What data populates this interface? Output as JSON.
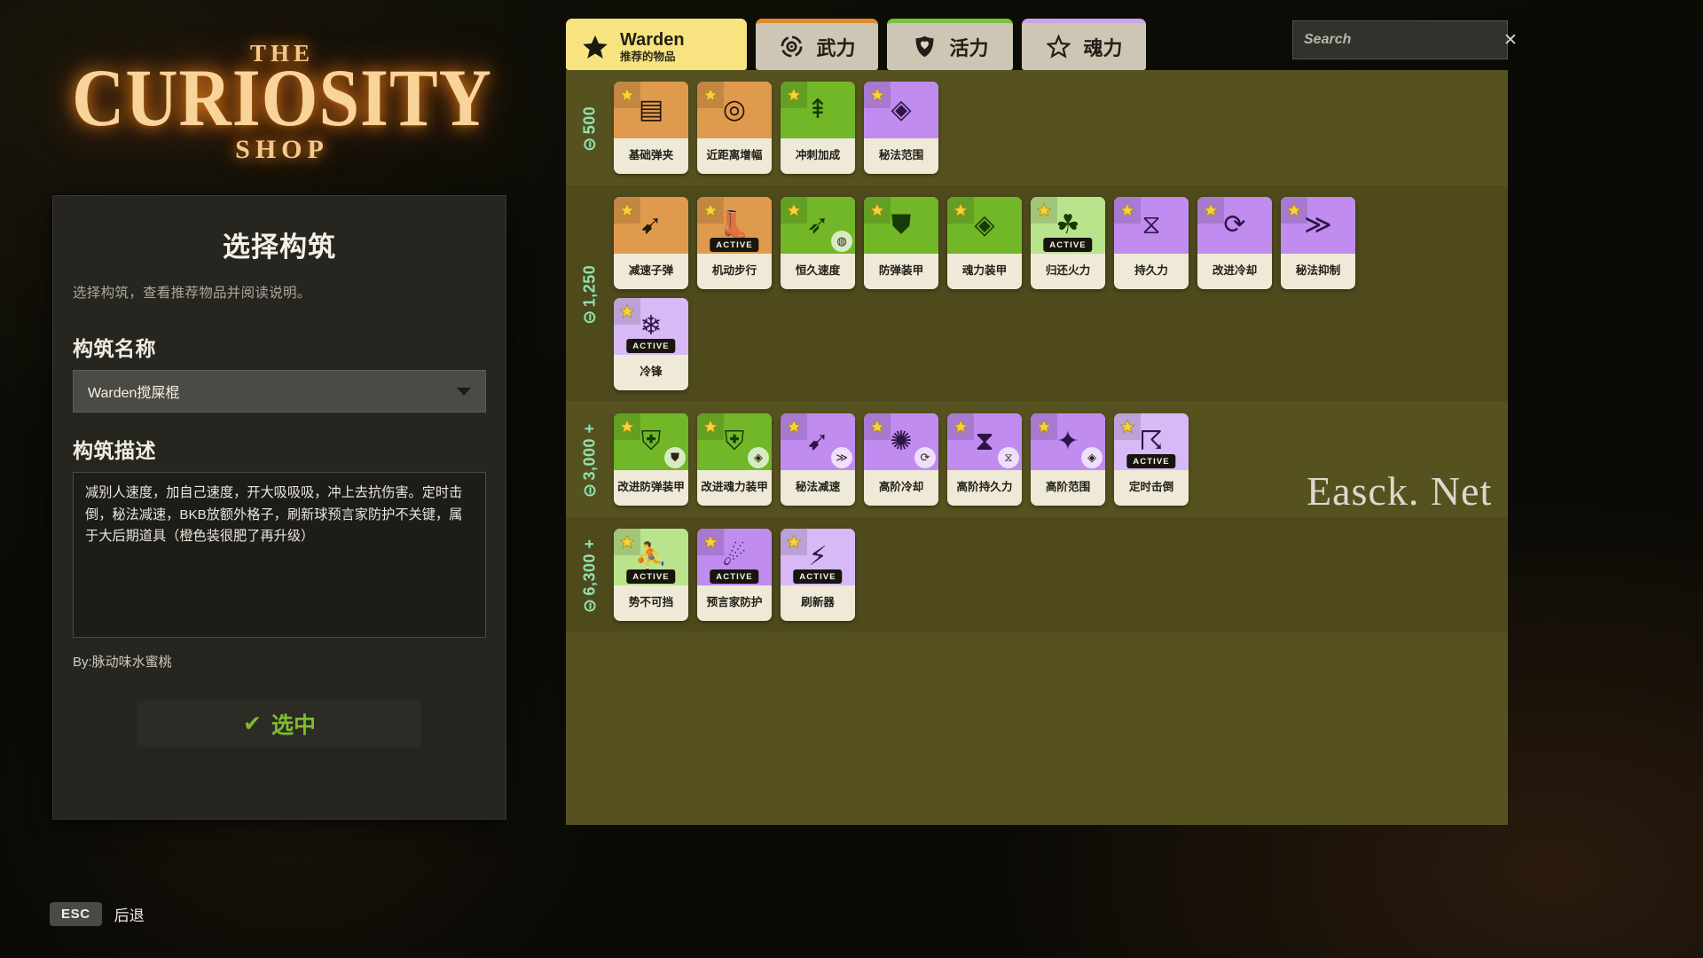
{
  "logo": {
    "the": "THE",
    "main": "CURIOSITY",
    "shop": "SHOP"
  },
  "build_panel": {
    "title": "选择构筑",
    "subtitle": "选择构筑，查看推荐物品并阅读说明。",
    "name_label": "构筑名称",
    "selected_build": "Warden搅屎棍",
    "desc_label": "构筑描述",
    "description": "减别人速度，加自己速度，开大吸吸吸，冲上去抗伤害。定时击倒，秘法减速，BKB放额外格子，刷新球预言家防护不关键，属于大后期道具（橙色装很肥了再升级）",
    "byline": "By:脉动味水蜜桃",
    "select_button": "选中",
    "check_glyph": "✔"
  },
  "footer": {
    "key": "ESC",
    "label": "后退"
  },
  "watermark": "Easck. Net",
  "search": {
    "placeholder": "Search",
    "value": "",
    "clear_glyph": "✕"
  },
  "tabs": [
    {
      "id": "warden",
      "label": "Warden",
      "sublabel": "推荐的物品",
      "icon": "star-icon",
      "accent": "#f7e380",
      "active": true
    },
    {
      "id": "weapon",
      "label": "武力",
      "icon": "target-icon",
      "accent": "#e08a2a",
      "active": false
    },
    {
      "id": "vitality",
      "label": "活力",
      "icon": "shield-heart-icon",
      "accent": "#7cc13a",
      "active": false
    },
    {
      "id": "spirit",
      "label": "魂力",
      "icon": "star-outline-icon",
      "accent": "#c9a6ea",
      "active": false
    }
  ],
  "tiers": [
    {
      "price": "500",
      "items": [
        {
          "name": "基础弹夹",
          "category": "weapon",
          "glyph": "▤",
          "active": false,
          "upgrade": null
        },
        {
          "name": "近距离增幅",
          "category": "weapon",
          "glyph": "◎",
          "active": false,
          "upgrade": null
        },
        {
          "name": "冲刺加成",
          "category": "vitality",
          "glyph": "⇞",
          "active": false,
          "upgrade": null
        },
        {
          "name": "秘法范围",
          "category": "spirit",
          "glyph": "◈",
          "active": false,
          "upgrade": null
        }
      ]
    },
    {
      "price": "1,250",
      "items": [
        {
          "name": "减速子弹",
          "category": "weapon",
          "glyph": "➹",
          "active": false,
          "upgrade": null
        },
        {
          "name": "机动步行",
          "category": "weapon-l",
          "glyph": "👢",
          "active": true,
          "upgrade": null
        },
        {
          "name": "恒久速度",
          "category": "vitality",
          "glyph": "➶",
          "active": false,
          "upgrade": "◍"
        },
        {
          "name": "防弹装甲",
          "category": "vitality",
          "glyph": "⛊",
          "active": false,
          "upgrade": null
        },
        {
          "name": "魂力装甲",
          "category": "vitality",
          "glyph": "◈",
          "active": false,
          "upgrade": null
        },
        {
          "name": "归还火力",
          "category": "vitality-l",
          "glyph": "☘",
          "active": true,
          "upgrade": null
        },
        {
          "name": "持久力",
          "category": "spirit",
          "glyph": "⧖",
          "active": false,
          "upgrade": null
        },
        {
          "name": "改进冷却",
          "category": "spirit",
          "glyph": "⟳",
          "active": false,
          "upgrade": null
        },
        {
          "name": "秘法抑制",
          "category": "spirit",
          "glyph": "≫",
          "active": false,
          "upgrade": null
        },
        {
          "name": "冷锋",
          "category": "spirit-l",
          "glyph": "❄",
          "active": true,
          "upgrade": null
        }
      ]
    },
    {
      "price": "3,000 +",
      "items": [
        {
          "name": "改进防弹装甲",
          "category": "vitality",
          "glyph": "⛨",
          "active": false,
          "upgrade": "⛊"
        },
        {
          "name": "改进魂力装甲",
          "category": "vitality",
          "glyph": "⛨",
          "active": false,
          "upgrade": "◈"
        },
        {
          "name": "秘法减速",
          "category": "spirit",
          "glyph": "➹",
          "active": false,
          "upgrade": "≫"
        },
        {
          "name": "高阶冷却",
          "category": "spirit",
          "glyph": "✺",
          "active": false,
          "upgrade": "⟳"
        },
        {
          "name": "高阶持久力",
          "category": "spirit",
          "glyph": "⧗",
          "active": false,
          "upgrade": "⧖"
        },
        {
          "name": "高阶范围",
          "category": "spirit",
          "glyph": "✦",
          "active": false,
          "upgrade": "◈"
        },
        {
          "name": "定时击倒",
          "category": "spirit-l",
          "glyph": "☈",
          "active": true,
          "upgrade": null
        }
      ]
    },
    {
      "price": "6,300 +",
      "items": [
        {
          "name": "势不可挡",
          "category": "vitality-l",
          "glyph": "⛹",
          "active": true,
          "upgrade": null
        },
        {
          "name": "预言家防护",
          "category": "spirit",
          "glyph": "☄",
          "active": true,
          "upgrade": null
        },
        {
          "name": "刷新器",
          "category": "spirit-l",
          "glyph": "⚡",
          "active": true,
          "upgrade": null
        }
      ]
    }
  ]
}
